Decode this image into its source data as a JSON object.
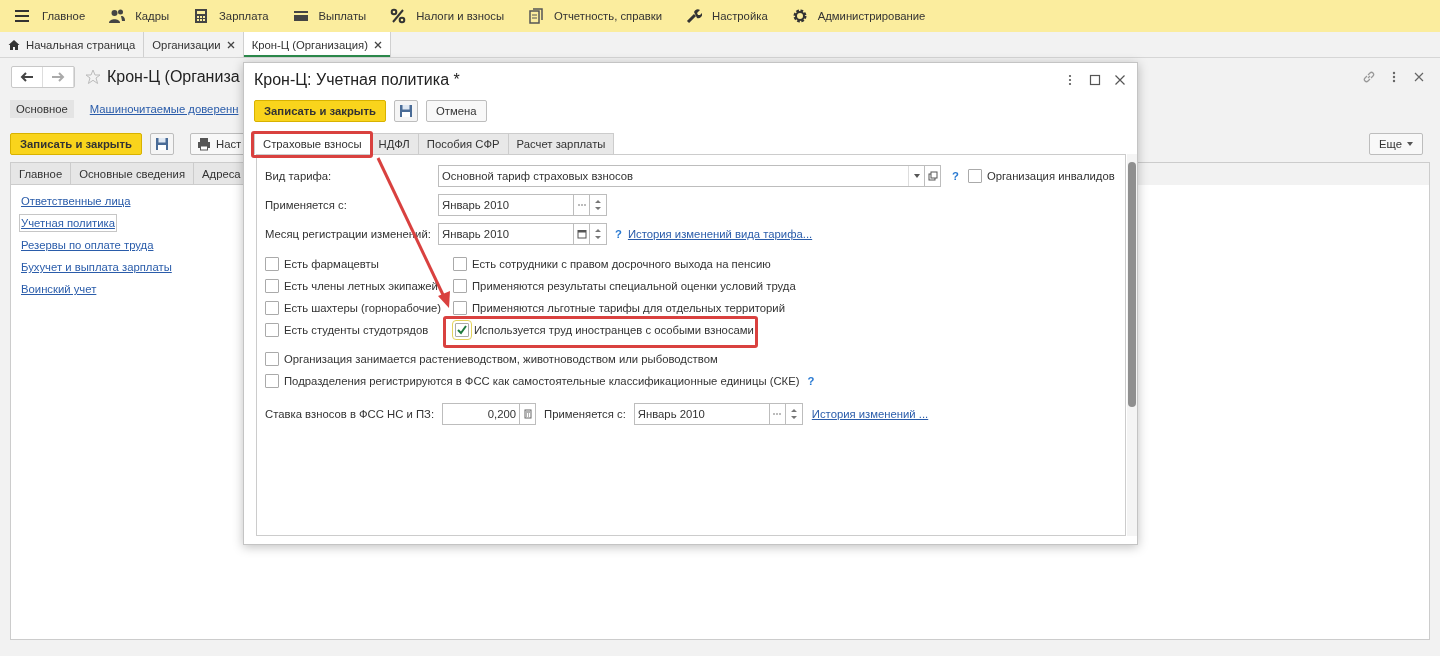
{
  "menu": [
    {
      "label": "Главное"
    },
    {
      "label": "Кадры"
    },
    {
      "label": "Зарплата"
    },
    {
      "label": "Выплаты"
    },
    {
      "label": "Налоги и взносы"
    },
    {
      "label": "Отчетность, справки"
    },
    {
      "label": "Настройка"
    },
    {
      "label": "Администрирование"
    }
  ],
  "open_tabs": [
    {
      "label": "Начальная страница",
      "selected": false,
      "closable": false
    },
    {
      "label": "Организации",
      "selected": false,
      "closable": true
    },
    {
      "label": "Крон-Ц (Организация)",
      "selected": true,
      "closable": true
    }
  ],
  "form": {
    "title": "Крон-Ц (Организа",
    "sections": [
      {
        "label": "Основное",
        "selected": true
      },
      {
        "label": "Машиночитаемые доверенн",
        "selected": false
      }
    ],
    "save_close": "Записать и закрыть",
    "print": "Наст",
    "more": "Еще",
    "tabs": [
      "Главное",
      "Основные сведения",
      "Адреса"
    ],
    "links": [
      {
        "label": "Ответственные лица",
        "selected": false
      },
      {
        "label": "Учетная политика",
        "selected": true
      },
      {
        "label": "Резервы по оплате труда",
        "selected": false
      },
      {
        "label": "Бухучет и выплата зарплаты",
        "selected": false
      },
      {
        "label": "Воинский учет",
        "selected": false
      }
    ]
  },
  "dialog": {
    "title": "Крон-Ц: Учетная политика *",
    "save_close": "Записать и закрыть",
    "cancel": "Отмена",
    "tabs": [
      {
        "label": "Страховые взносы",
        "selected": true
      },
      {
        "label": "НДФЛ",
        "selected": false
      },
      {
        "label": "Пособия СФР",
        "selected": false
      },
      {
        "label": "Расчет зарплаты",
        "selected": false
      }
    ],
    "tariff": {
      "label": "Вид тарифа:",
      "value": "Основной тариф страховых взносов",
      "help": "?"
    },
    "disabled_org": {
      "label": "Организация инвалидов",
      "checked": false
    },
    "applies_from": {
      "label": "Применяется с:",
      "value": "Январь 2010"
    },
    "reg_month": {
      "label": "Месяц регистрации изменений:",
      "value": "Январь 2010",
      "help": "?",
      "link": "История изменений вида тарифа..."
    },
    "checks_left": [
      {
        "label": "Есть фармацевты",
        "checked": false
      },
      {
        "label": "Есть члены летных экипажей",
        "checked": false
      },
      {
        "label": "Есть шахтеры (горнорабочие)",
        "checked": false
      },
      {
        "label": "Есть студенты студотрядов",
        "checked": false
      }
    ],
    "checks_right": [
      {
        "label": "Есть сотрудники с правом досрочного выхода на пенсию",
        "checked": false
      },
      {
        "label": "Применяются результаты специальной оценки условий труда",
        "checked": false
      },
      {
        "label": "Применяются льготные тарифы для отдельных территорий",
        "checked": false
      },
      {
        "label": "Используется труд иностранцев с особыми взносами",
        "checked": true
      }
    ],
    "checks_wide": [
      {
        "label": "Организация занимается растениеводством, животноводством или рыбоводством",
        "checked": false
      },
      {
        "label": "Подразделения регистрируются в ФСС как самостоятельные классификационные единицы (СКЕ)",
        "checked": false,
        "help": "?"
      }
    ],
    "rate": {
      "label": "Ставка взносов в ФСС НС и ПЗ:",
      "value": "0,200",
      "from_label": "Применяется с:",
      "from_value": "Январь 2010",
      "link": "История изменений ..."
    }
  }
}
